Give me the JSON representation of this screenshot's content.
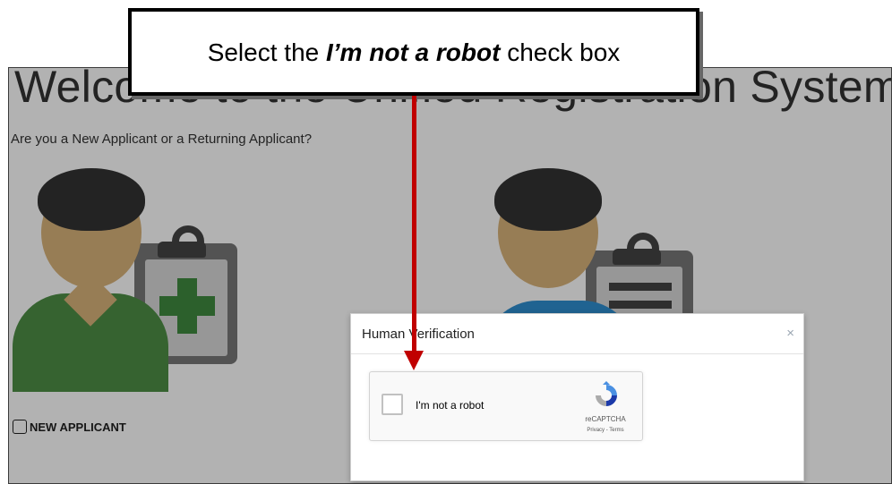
{
  "page": {
    "title": "Welcome to the Unified Registration System.",
    "subtitle": "Are you a New Applicant or a Returning Applicant?",
    "choices": {
      "new_applicant": "NEW APPLICANT"
    }
  },
  "modal": {
    "title": "Human Verification",
    "close": "×",
    "recaptcha": {
      "label": "I'm not a robot",
      "brand": "reCAPTCHA",
      "links": "Privacy - Terms"
    }
  },
  "callout": {
    "prefix": "Select the ",
    "emphasis": "I’m not a robot",
    "suffix": " check box"
  },
  "colors": {
    "arrow": "#c00000",
    "green": "#3f8a3f",
    "skin": "#d9b37a",
    "hair": "#333333",
    "blue_shirt": "#2f8fd0"
  },
  "icons": {
    "new_applicant": "user-clipboard-plus-icon",
    "returning_applicant": "user-clipboard-list-icon",
    "recaptcha": "recaptcha-logo-icon"
  }
}
